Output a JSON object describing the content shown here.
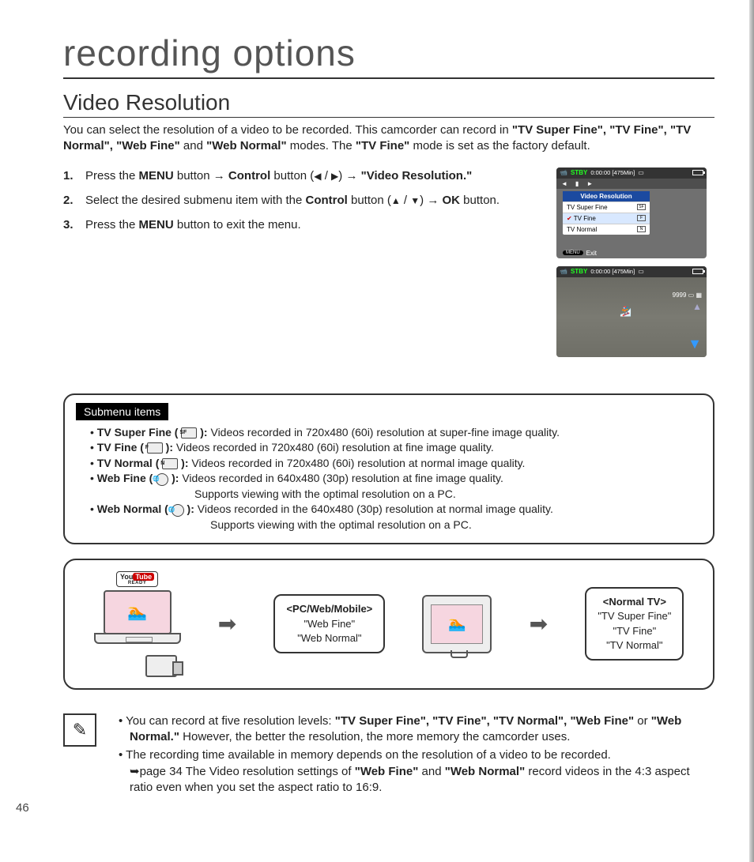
{
  "page_number": "46",
  "chapter_title": "recording options",
  "section_title": "Video Resolution",
  "intro": {
    "t1": "You can select the resolution of a video to be recorded. This camcorder can record in ",
    "b1": "\"TV Super Fine\", \"TV Fine\", \"TV Normal\", \"Web Fine\"",
    "t2": " and ",
    "b2": "\"Web Normal\"",
    "t3": " modes. The ",
    "b3": "\"TV Fine\"",
    "t4": " mode is set as the factory default."
  },
  "steps": [
    {
      "num": "1.",
      "pre": "Press the ",
      "b1": "MENU",
      "mid1": " button → ",
      "b2": "Control",
      "mid2": " button (",
      "mid3": " / ",
      "mid4": ") → ",
      "b3": "\"Video Resolution.\""
    },
    {
      "num": "2.",
      "pre": "Select the desired submenu item with the ",
      "b1": "Control",
      "mid1": " button (",
      "mid2": " / ",
      "mid3": ") → ",
      "b2": "OK",
      "post": " button."
    },
    {
      "num": "3.",
      "pre": "Press the ",
      "b1": "MENU",
      "post": " button to exit the menu."
    }
  ],
  "screen1": {
    "stby": "STBY",
    "time": "0:00:00 [475Min]",
    "menu_title": "Video Resolution",
    "items": [
      "TV Super Fine",
      "TV Fine",
      "TV Normal"
    ],
    "exit_btn": "MENU",
    "exit_label": "Exit"
  },
  "screen2": {
    "stby": "STBY",
    "time": "0:00:00 [475Min]",
    "counter": "9999"
  },
  "submenu_label": "Submenu items",
  "submenu": [
    {
      "name": "TV Super Fine ( ",
      "desc": "Videos recorded in 720x480 (60i) resolution at super-fine image quality."
    },
    {
      "name": "TV Fine ( ",
      "desc": "Videos recorded in 720x480 (60i) resolution at fine image quality."
    },
    {
      "name": "TV Normal ( ",
      "desc": "Videos recorded in 720x480 (60i) resolution at normal image quality."
    },
    {
      "name": "Web Fine ( ",
      "desc": "Videos recorded in 640x480 (30p) resolution at fine image quality."
    },
    {
      "name": "Web Normal ( ",
      "desc": "Videos recorded in the 640x480 (30p) resolution at normal image quality."
    }
  ],
  "support_line": "Supports viewing with the optimal resolution on a PC.",
  "flow": {
    "yt_label1": "You",
    "yt_label2": "Tube",
    "yt_sub": "READY",
    "card1_title": "<PC/Web/Mobile>",
    "card1_l1": "\"Web Fine\"",
    "card1_l2": "\"Web Normal\"",
    "card2_title": "<Normal TV>",
    "card2_l1": "\"TV Super Fine\"",
    "card2_l2": "\"TV Fine\"",
    "card2_l3": "\"TV Normal\""
  },
  "notes": {
    "n1a": "You can record at five resolution levels: ",
    "n1b": "\"TV Super Fine\", \"TV Fine\", \"TV Normal\", \"Web Fine\"",
    "n1c": " or ",
    "n1d": "\"Web Normal.\"",
    "n1e": " However, the better the resolution, the more memory the camcorder uses.",
    "n2a": "The recording time available in memory depends on the resolution of a video to be recorded. ",
    "n2b": "page 34 The Video resolution settings of ",
    "n2c": "\"Web Fine\"",
    "n2d": " and ",
    "n2e": "\"Web Normal\"",
    "n2f": " record videos in the 4:3 aspect ratio even when you set the aspect ratio to 16:9."
  }
}
